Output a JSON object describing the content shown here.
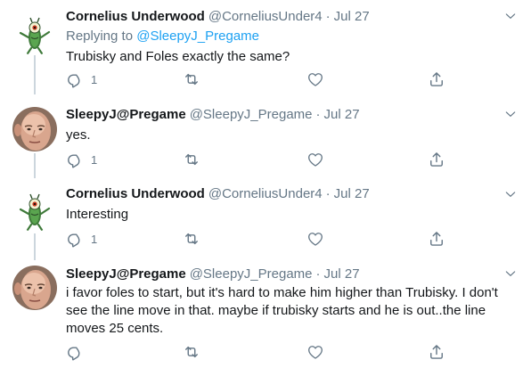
{
  "tweets": [
    {
      "name": "Cornelius Underwood",
      "handle": "@CorneliusUnder4",
      "separator": "·",
      "time": "Jul 27",
      "replying_prefix": "Replying to",
      "replying_to": "@SleepyJ_Pregame",
      "text": "Trubisky and Foles exactly the same?",
      "reply_count": "1",
      "avatar_icon": "plankton-avatar-icon"
    },
    {
      "name": "SleepyJ@Pregame",
      "handle": "@SleepyJ_Pregame",
      "separator": "·",
      "time": "Jul 27",
      "text": "yes.",
      "reply_count": "1",
      "avatar_icon": "face-avatar-icon"
    },
    {
      "name": "Cornelius Underwood",
      "handle": "@CorneliusUnder4",
      "separator": "·",
      "time": "Jul 27",
      "text": "Interesting",
      "reply_count": "1",
      "avatar_icon": "plankton-avatar-icon"
    },
    {
      "name": "SleepyJ@Pregame",
      "handle": "@SleepyJ_Pregame",
      "separator": "·",
      "time": "Jul 27",
      "text": "i favor foles to start, but it's hard to make him higher than Trubisky. I don't see the line move in that. maybe if trubisky starts and he is out..the line moves 25 cents.",
      "reply_count": "",
      "avatar_icon": "face-avatar-icon"
    }
  ],
  "colors": {
    "name": "#14171a",
    "secondary": "#657786",
    "link": "#1da1f2",
    "thread_line": "#ccd6dd"
  },
  "icons": [
    "reply-icon",
    "retweet-icon",
    "like-icon",
    "share-icon",
    "chevron-down-icon"
  ]
}
